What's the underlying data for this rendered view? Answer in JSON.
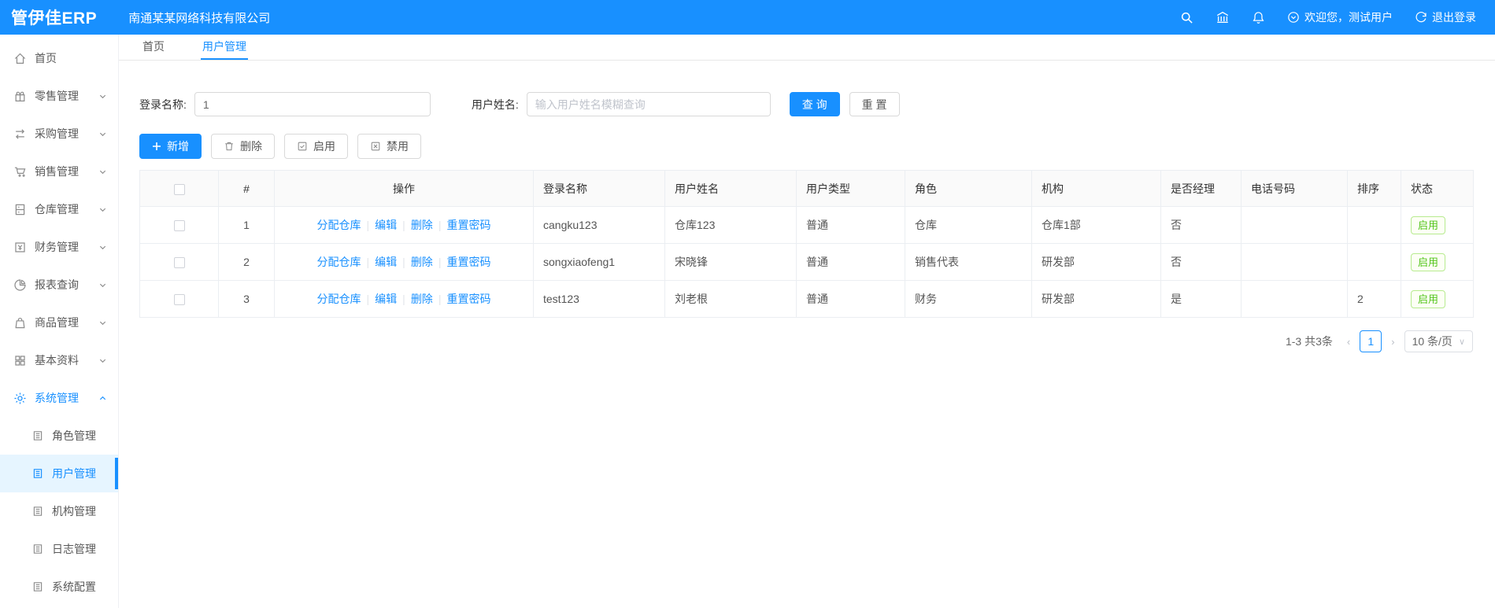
{
  "header": {
    "logo": "管伊佳ERP",
    "company": "南通某某网络科技有限公司",
    "welcome": "欢迎您，测试用户",
    "logout": "退出登录"
  },
  "sidebar": {
    "items": [
      {
        "label": "首页",
        "icon": "home-icon",
        "type": "item",
        "chevron": ""
      },
      {
        "label": "零售管理",
        "icon": "retail-icon",
        "type": "item",
        "chevron": "down"
      },
      {
        "label": "采购管理",
        "icon": "purchase-icon",
        "type": "item",
        "chevron": "down"
      },
      {
        "label": "销售管理",
        "icon": "sales-icon",
        "type": "item",
        "chevron": "down"
      },
      {
        "label": "仓库管理",
        "icon": "warehouse-icon",
        "type": "item",
        "chevron": "down"
      },
      {
        "label": "财务管理",
        "icon": "finance-icon",
        "type": "item",
        "chevron": "down"
      },
      {
        "label": "报表查询",
        "icon": "report-icon",
        "type": "item",
        "chevron": "down"
      },
      {
        "label": "商品管理",
        "icon": "goods-icon",
        "type": "item",
        "chevron": "down"
      },
      {
        "label": "基本资料",
        "icon": "basedata-icon",
        "type": "item",
        "chevron": "down"
      },
      {
        "label": "系统管理",
        "icon": "gear-icon",
        "type": "item",
        "chevron": "up",
        "activeParent": true
      },
      {
        "label": "角色管理",
        "icon": "doc-icon",
        "type": "sub"
      },
      {
        "label": "用户管理",
        "icon": "doc-icon",
        "type": "sub",
        "selected": true
      },
      {
        "label": "机构管理",
        "icon": "doc-icon",
        "type": "sub"
      },
      {
        "label": "日志管理",
        "icon": "doc-icon",
        "type": "sub"
      },
      {
        "label": "系统配置",
        "icon": "doc-icon",
        "type": "sub"
      }
    ]
  },
  "tabs": [
    {
      "label": "首页",
      "active": false
    },
    {
      "label": "用户管理",
      "active": true
    }
  ],
  "filters": {
    "login_label": "登录名称:",
    "login_value": "1",
    "name_label": "用户姓名:",
    "name_placeholder": "输入用户姓名模糊查询",
    "search_label": "查 询",
    "reset_label": "重 置"
  },
  "toolbar": {
    "add_label": "新增",
    "delete_label": "删除",
    "enable_label": "启用",
    "disable_label": "禁用"
  },
  "table": {
    "headers": [
      "#",
      "操作",
      "登录名称",
      "用户姓名",
      "用户类型",
      "角色",
      "机构",
      "是否经理",
      "电话号码",
      "排序",
      "状态"
    ],
    "action_links": [
      "分配仓库",
      "编辑",
      "删除",
      "重置密码"
    ],
    "rows": [
      {
        "index": "1",
        "login": "cangku123",
        "name": "仓库123",
        "type": "普通",
        "role": "仓库",
        "org": "仓库1部",
        "manager": "否",
        "phone": "",
        "sort": "",
        "status": "启用"
      },
      {
        "index": "2",
        "login": "songxiaofeng1",
        "name": "宋晓锋",
        "type": "普通",
        "role": "销售代表",
        "org": "研发部",
        "manager": "否",
        "phone": "",
        "sort": "",
        "status": "启用"
      },
      {
        "index": "3",
        "login": "test123",
        "name": "刘老根",
        "type": "普通",
        "role": "财务",
        "org": "研发部",
        "manager": "是",
        "phone": "",
        "sort": "2",
        "status": "启用"
      }
    ]
  },
  "pagination": {
    "total_text": "1-3 共3条",
    "prev": "‹",
    "current_page": "1",
    "next": "›",
    "page_size": "10 条/页"
  }
}
